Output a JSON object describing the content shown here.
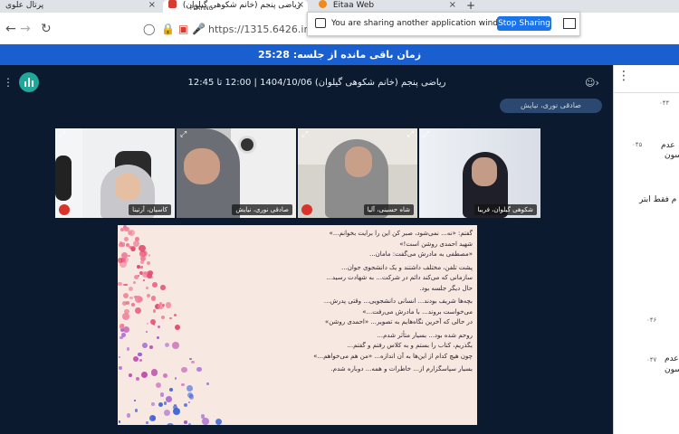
{
  "browser": {
    "tabs": [
      {
        "title": "پرتال علوی",
        "close": "×"
      },
      {
        "title": "ریاضی پنجم (خانم شکوهی گیلوان)",
        "status": "PLAYING",
        "close": "×"
      },
      {
        "title": "Eitaa Web",
        "close": "×"
      }
    ],
    "new_tab": "+",
    "url": "https://1315.6426.ir/h",
    "sharing_message": "You are sharing another application window.",
    "stop_sharing_label": "Stop Sharing"
  },
  "session": {
    "time_remaining": "زمان باقی مانده از جلسه: 25:28",
    "title": "ریاضی پنجم (خانم شکوهی گیلوان) 1404/10/06 | 12:00 تا 12:45",
    "speaker_chip": "صادقی نوری، نیایش"
  },
  "participants": [
    {
      "name": "کاسیان، آرتینا",
      "muted": true
    },
    {
      "name": "صادقی نوری، نیایش",
      "muted": false
    },
    {
      "name": "شاه حسینی، آلیا",
      "muted": true
    },
    {
      "name": "شکوهی گیلوان، فریبا",
      "muted": false
    }
  ],
  "document": {
    "lines": [
      "گفتم: «نه... نمی‌شود، صبر کن این را برایت بخوانم...»",
      "شهید احمدی روشن است!»",
      "«مصطفی به مادرش می‌گفت: مامان...",
      "پشت تلفن، مختلف داشتند و یک دانشجوی جوان...",
      "سازمانی که می‌کند دائم در شرکت... به شهادت رسید...",
      "حال دیگر جلسه بود.",
      "بچه‌ها شریف بودند... انسانی دانشجویی... وقتی پدرش...",
      "می‌خواست بروند... با مادرش می‌رفت...»",
      "در حالی که آخرین نگاه‌هایم به تصویر... «احمدی روشن»",
      "روحم شده بود... بسیار متأثر شدم...",
      "بگذریم، کتاب را بستم و به کلاس رفتم و گفتم...",
      "چون هیچ کدام از این‌ها به آن اندازه... «من هم می‌خواهم...»",
      "بسیار سپاسگزارم از... خاطرات و همه... دوباره شدم."
    ]
  },
  "chat": {
    "times": [
      "۰۴۴",
      "۰۴۵",
      "۰۴۶",
      "۰۴۷"
    ],
    "snippets": [
      "عدم",
      "سون)",
      "م فقط ابتر",
      "عدم",
      "سون)"
    ]
  },
  "colors": {
    "timer_bar": "#1a5fd0",
    "background": "#0b1a2e",
    "stop_button": "#1a73e8"
  }
}
